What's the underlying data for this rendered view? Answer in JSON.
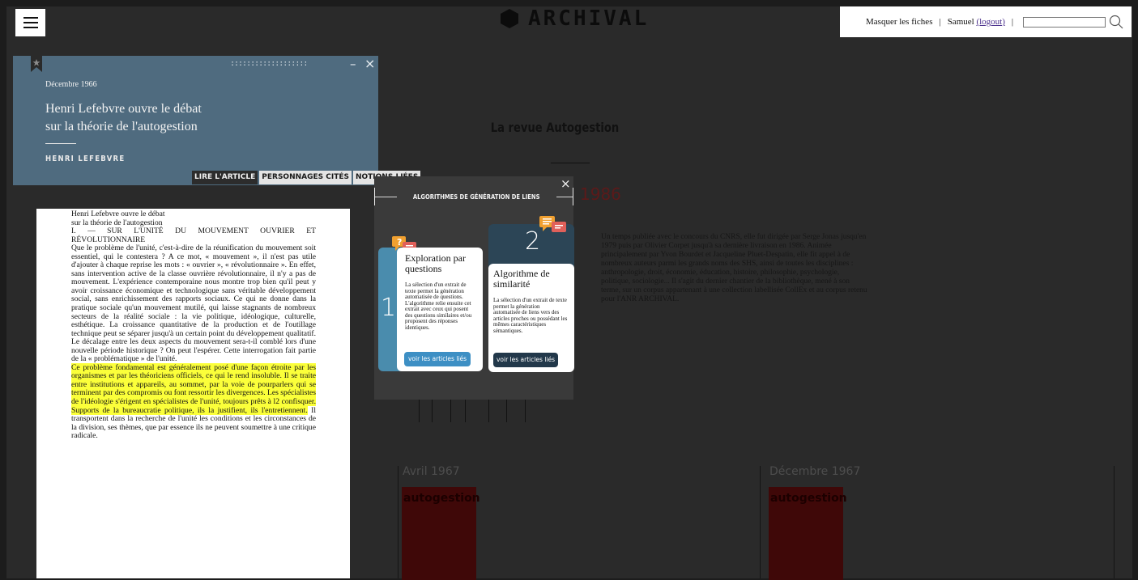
{
  "header": {
    "logo_text": "ARCHIVAL",
    "hide_cards_link": "Masquer les fiches",
    "separator": "|",
    "user_name": "Samuel",
    "logout_link": "(logout)",
    "search_value": ""
  },
  "background": {
    "section_title": "La revue Autogestion",
    "year": "1986",
    "description": "Un temps publiée avec le concours du CNRS, elle fut dirigée par Serge Jonas jusqu'en 1979 puis par Olivier Corpet jusqu'à sa dernière livraison en 1986. Animée principalement par Yvon Bourdet et Jacqueline Pluet-Despatin, elle fit appel à de nombreux auteurs parmi les grands noms des SHS, ainsi de toutes les disciplines : anthropologie, droit, économie, éducation, histoire, philosophie, psychologie, politique, sociologie... Il s'agit du dernier chantier de la bibliothèque, mené à son terme, sur un corpus appartenant à une collection labellisée CollEx et au corpus retenu pour l'ANR ARCHIVAL.",
    "cards": [
      {
        "date": "Avril 1967",
        "cover_title": "autogestion"
      },
      {
        "date": "Décembre 1967",
        "cover_title": "autogestion"
      }
    ]
  },
  "article": {
    "date": "Décembre 1966",
    "title_line1": "Henri Lefebvre ouvre le débat",
    "title_line2": "sur la théorie de l'autogestion",
    "author": "HENRI LEFEBVRE",
    "window_dots": ":::::::::::::::::::",
    "minimize_symbol": "–",
    "close_symbol": "×",
    "tabs": [
      {
        "label": "LIRE L'ARTICLE",
        "active": true
      },
      {
        "label": "PERSONNAGES CITÉS",
        "active": false
      },
      {
        "label": "NOTIONS LIÉES",
        "active": false
      }
    ],
    "body": {
      "line1": "Henri Lefebvre ouvre le débat",
      "line2": "sur la théorie de l'autogestion",
      "line3": "I. — SUR L'UNITÉ DU MOUVEMENT OUVRIER ET RÉVOLUTIONNAIRE",
      "para1": "Que le problème de l'unité, c'est-à-dire de la réunification du mouvement soit essentiel, qui le contestera ? A ce mot, « mouvement », il n'est pas utile d'ajouter à chaque reprise les mots : « ouvrier », « révolutionnaire ». En effet, sans intervention active de la classe ouvrière révolutionnaire, il n'y a pas de mouvement. L'expérience contemporaine nous montre trop bien qu'il peut y avoir croissance économique et technologique sans véritable développement social, sans enrichissement des rapports sociaux. Ce qui ne donne dans la pratique sociale qu'un mouvement mutilé, qui laisse stagnants de nombreux secteurs de la réalité sociale : la vie politique, idéologique, culturelle, esthétique. La croissance quantitative de la production et de l'outillage technique peut se séparer jusqu'à un certain point du développement qualitatif. Le décalage entre les deux aspects du mouvement sera-t-il comblé lors d'une nouvelle période historique ? On peut l'espérer. Cette interrogation fait partie de la « problématique » de l'unité.",
      "para2_highlighted": "Ce problème fondamental est généralement posé d'une façon étroite par les organismes et par les théoriciens officiels, ce qui le rend insoluble. Il se traite entre institutions et appareils, au sommet, par la voie de pourparlers qui se terminent par des compromis ou font ressortir les divergences. Les spécialistes de l'idéologie s'érigent en spécialistes de l'unité, toujours prêts à l2 confisquer. Supports de la bureaucratie politique, ils la justifient, ils l'entretiennent.",
      "para2_rest": " Il transportent dans la recherche de l'unité les conditions et les circonstances de la division, ses thèmes, que par essence ils ne peuvent soumettre à une critique radicale."
    }
  },
  "algorithms": {
    "title": "ALGORITHMES DE GÉNÉRATION DE LIENS",
    "close_symbol": "×",
    "cards": [
      {
        "number": "1",
        "title": "Exploration par questions",
        "description": "La sélection d'un extrait de texte permet la génération automatisée de questions. L'algorithme relie ensuite cet extrait avec ceux qui posent des questions similaires et/ou proposent des réponses identiques.",
        "button": "voir les articles liés",
        "accent": "#4a8cad",
        "button_color": "#3d8fc4"
      },
      {
        "number": "2",
        "title": "Algorithme de similarité",
        "description": "La sélection d'un extrait de texte permet la génération automatisée de liens vers des articles proches ou possédant les mêmes caractéristiques sémantiques.",
        "button": "voir les articles liés",
        "accent": "#2c4556",
        "button_color": "#22384a"
      }
    ],
    "icon_colors": {
      "orange": "#f0a030",
      "red": "#e0605a"
    }
  }
}
